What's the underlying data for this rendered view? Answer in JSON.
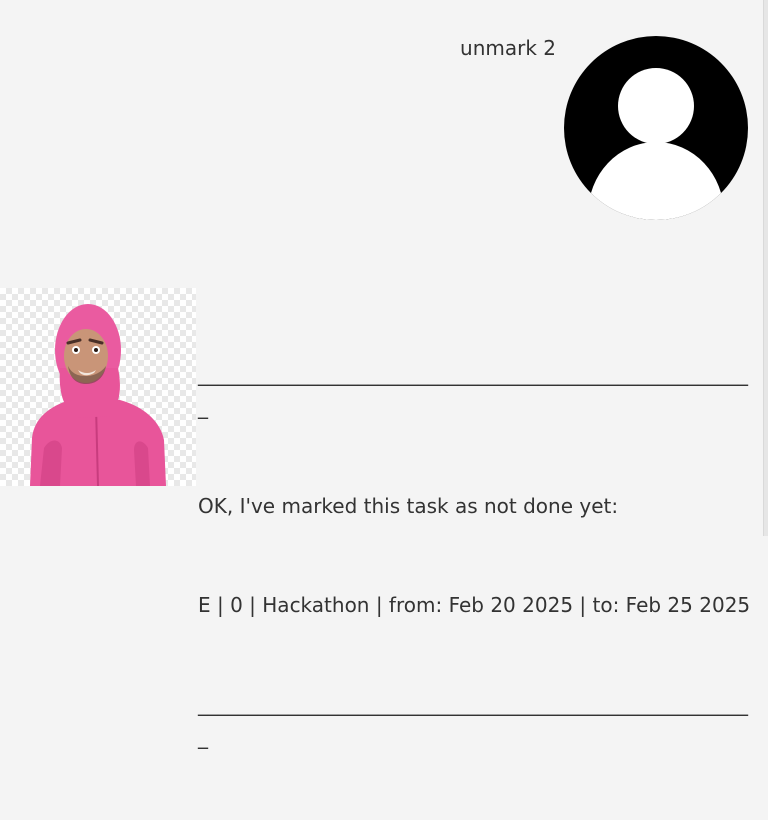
{
  "conversation": {
    "user_message": {
      "text": "unmark 2",
      "avatar_icon": "default-user-avatar-icon"
    },
    "bot_message": {
      "avatar_icon": "pink-hooded-character-avatar",
      "lines": [
        "________________________________________________________",
        "OK, I've marked this task as not done yet:",
        "E | 0 | Hackathon | from: Feb 20 2025 | to: Feb 25 2025",
        "________________________________________________________"
      ]
    }
  },
  "colors": {
    "background": "#f4f4f4",
    "text": "#333333",
    "avatar_bg": "#000000",
    "avatar_fg": "#ffffff",
    "character_pink": "#e8559a"
  }
}
